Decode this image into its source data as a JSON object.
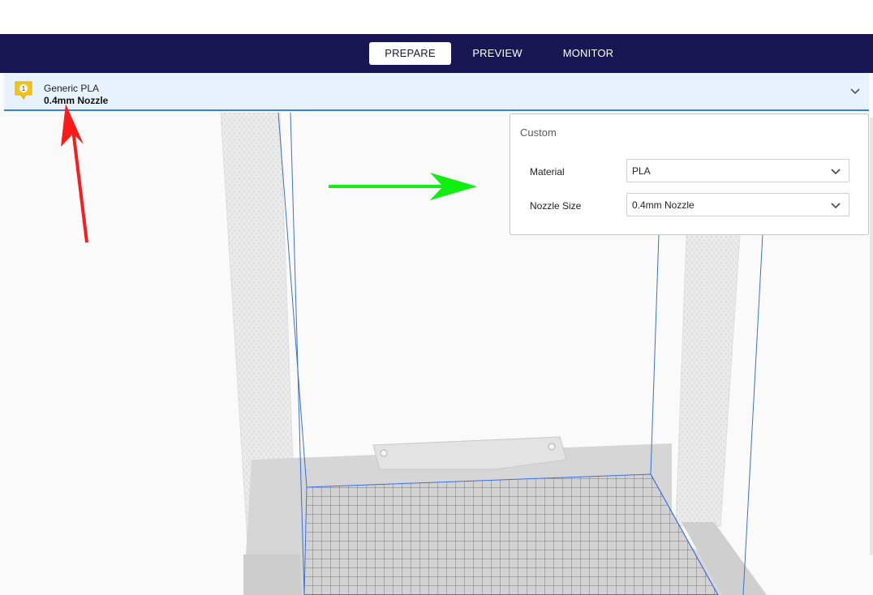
{
  "tabs": [
    {
      "label": "PREPARE",
      "active": true
    },
    {
      "label": "PREVIEW",
      "active": false
    },
    {
      "label": "MONITOR",
      "active": false
    }
  ],
  "extruder": {
    "badge_number": "1",
    "material": "Generic PLA",
    "nozzle": "0.4mm Nozzle",
    "badge_icon": "extruder-badge-icon",
    "expand_icon": "chevron-down-icon"
  },
  "custom_panel": {
    "title": "Custom",
    "material_label": "Material",
    "material_value": "PLA",
    "nozzle_label": "Nozzle Size",
    "nozzle_value": "0.4mm Nozzle"
  },
  "colors": {
    "header_bg": "#191654",
    "accent_blue": "#3a82d6",
    "extruder_bar_bg": "#e8f2fc",
    "badge_yellow": "#f3c518",
    "annotation_red": "#ff1a1a",
    "annotation_green": "#11ee11"
  }
}
